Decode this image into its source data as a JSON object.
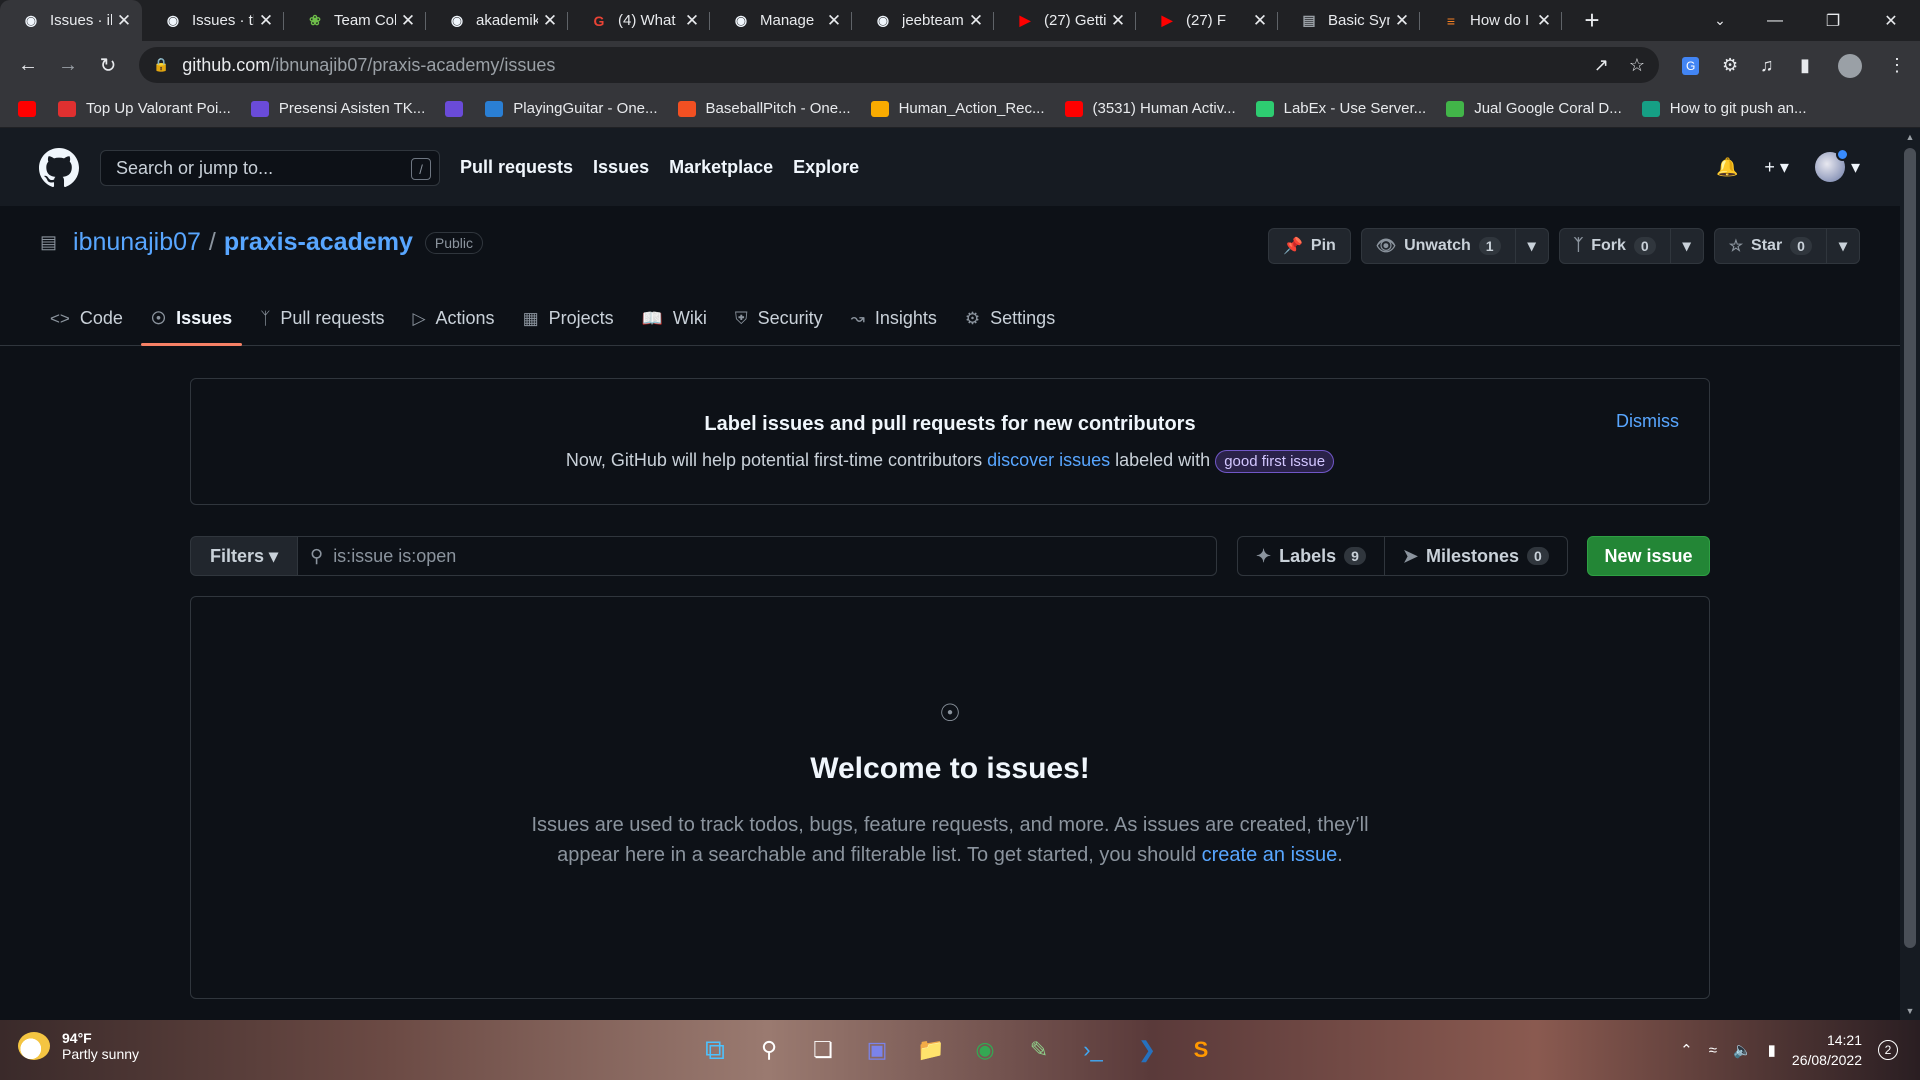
{
  "browser": {
    "tabs": [
      {
        "title": "Issues · ib",
        "icon": "github-icon",
        "active": true
      },
      {
        "title": "Issues · th",
        "icon": "github-icon"
      },
      {
        "title": "Team Coll",
        "icon": "leaf-icon"
      },
      {
        "title": "akademik",
        "icon": "github-icon"
      },
      {
        "title": "(4) What",
        "icon": "google-icon"
      },
      {
        "title": "Manage",
        "icon": "github-icon"
      },
      {
        "title": "jeebteam",
        "icon": "github-icon"
      },
      {
        "title": "(27) Getti",
        "icon": "youtube-icon"
      },
      {
        "title": "(27) F",
        "icon": "youtube-icon"
      },
      {
        "title": "Basic Syn",
        "icon": "page-icon"
      },
      {
        "title": "How do I",
        "icon": "stackoverflow-icon"
      }
    ],
    "url_host": "github.com",
    "url_path": "/ibnunajib07/praxis-academy/issues",
    "bookmarks": [
      {
        "label": "",
        "color": "#ff0000"
      },
      {
        "label": "Top Up Valorant Poi...",
        "color": "#e03030"
      },
      {
        "label": "Presensi Asisten TK...",
        "color": "#6a4bd8"
      },
      {
        "label": "",
        "color": "#6a4bd8"
      },
      {
        "label": "PlayingGuitar - One...",
        "color": "#2a7fd4"
      },
      {
        "label": "BaseballPitch - One...",
        "color": "#f25022"
      },
      {
        "label": "Human_Action_Rec...",
        "color": "#f9ab00"
      },
      {
        "label": "(3531) Human Activ...",
        "color": "#ff0000"
      },
      {
        "label": "LabEx - Use Server...",
        "color": "#2ecc71"
      },
      {
        "label": "Jual Google Coral D...",
        "color": "#42b549"
      },
      {
        "label": "How to git push an...",
        "color": "#16a085"
      }
    ]
  },
  "github": {
    "search_placeholder": "Search or jump to...",
    "search_key": "/",
    "nav": [
      "Pull requests",
      "Issues",
      "Marketplace",
      "Explore"
    ],
    "owner": "ibnunajib07",
    "repo": "praxis-academy",
    "visibility": "Public",
    "actions": {
      "pin": "Pin",
      "unwatch": "Unwatch",
      "unwatch_count": "1",
      "fork": "Fork",
      "fork_count": "0",
      "star": "Star",
      "star_count": "0"
    },
    "tabs": [
      {
        "label": "Code",
        "icon": "code-icon"
      },
      {
        "label": "Issues",
        "icon": "issue-icon",
        "active": true
      },
      {
        "label": "Pull requests",
        "icon": "pull-request-icon"
      },
      {
        "label": "Actions",
        "icon": "play-icon"
      },
      {
        "label": "Projects",
        "icon": "table-icon"
      },
      {
        "label": "Wiki",
        "icon": "book-icon"
      },
      {
        "label": "Security",
        "icon": "shield-icon"
      },
      {
        "label": "Insights",
        "icon": "graph-icon"
      },
      {
        "label": "Settings",
        "icon": "gear-icon"
      }
    ],
    "banner": {
      "title": "Label issues and pull requests for new contributors",
      "text_before": "Now, GitHub will help potential first-time contributors ",
      "link": "discover issues",
      "text_after": " labeled with ",
      "label": "good first issue",
      "dismiss": "Dismiss"
    },
    "filters": "Filters",
    "query": "is:issue is:open",
    "labels": "Labels",
    "labels_count": "9",
    "milestones": "Milestones",
    "milestones_count": "0",
    "new_issue": "New issue",
    "blank": {
      "title": "Welcome to issues!",
      "text": "Issues are used to track todos, bugs, feature requests, and more. As issues are created, they’ll appear here in a searchable and filterable list. To get started, you should ",
      "link": "create an issue",
      "end": "."
    }
  },
  "taskbar": {
    "temp": "94°F",
    "weather": "Partly sunny",
    "time": "14:21",
    "date": "26/08/2022",
    "notifications": "2"
  }
}
